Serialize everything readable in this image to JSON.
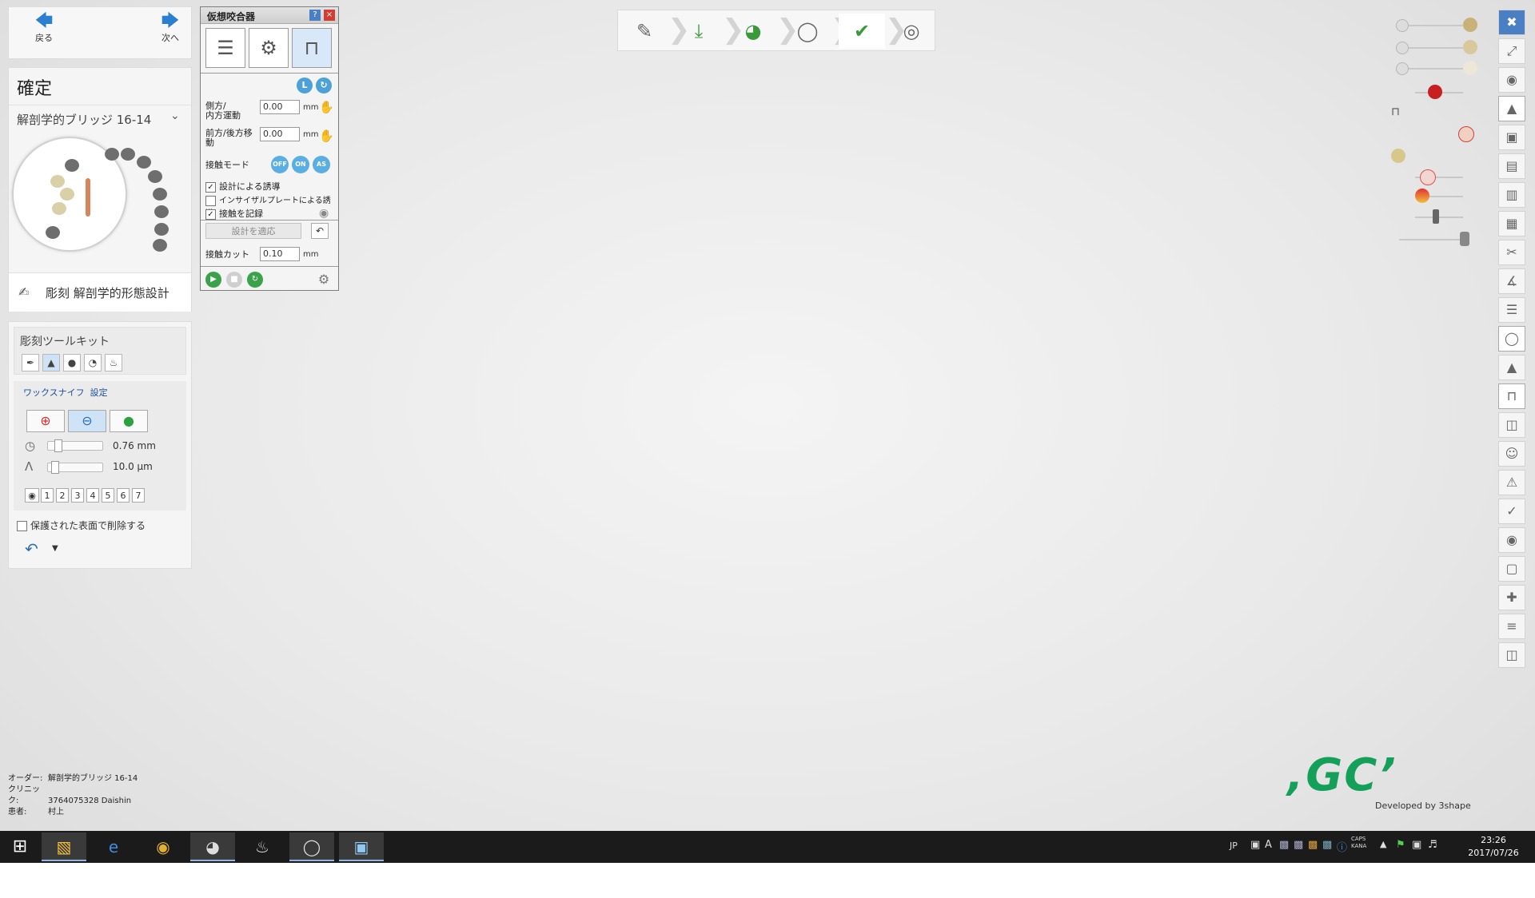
{
  "nav": {
    "back_label": "戻る",
    "next_label": "次へ"
  },
  "confirm_panel": {
    "title": "確定",
    "case_select": "解剖学的ブリッジ 16-14",
    "step_label": "彫刻 解剖学的形態設計"
  },
  "toolkit": {
    "title": "彫刻ツールキット",
    "wax_knife_label": "ワックスナイフ",
    "settings_label": "設定",
    "size_value": "0.76 mm",
    "strength_value": "10.0 μm",
    "numbers": [
      "1",
      "2",
      "3",
      "4",
      "5",
      "6",
      "7"
    ],
    "protect_label": "保護された表面で削除する"
  },
  "articulator": {
    "title": "仮想咬合器",
    "help": "?",
    "close": "×",
    "lateral_label": "側方/\n内方運動",
    "lateral_value": "0.00",
    "protrusive_label": "前方/後方移\n動",
    "protrusive_value": "0.00",
    "unit_mm": "mm",
    "contact_mode_label": "接触モード",
    "contact_modes": [
      "OFF",
      "ON",
      "AS"
    ],
    "check_design_guide": "設計による誘導",
    "check_incisal_guide": "インサイザルプレートによる誘導",
    "check_record_contact": "接触を記録",
    "apply_design": "設計を適応",
    "contact_cut_label": "接触カット",
    "contact_cut_value": "0.10"
  },
  "order_info": {
    "order_key": "オーダー:",
    "order_val": "解剖学的ブリッジ 16-14",
    "clinic_key": "クリニック:",
    "clinic_val": "3764075328 Daishin",
    "patient_key": "患者:",
    "patient_val": "村上"
  },
  "logo": {
    "mark": "‚GC’",
    "developed": "Developed by 3shape"
  },
  "taskbar": {
    "lang": "JP",
    "ime": "A",
    "caps": "CAPS",
    "kana": "KANA",
    "time": "23:26",
    "date": "2017/07/26"
  },
  "colors": {
    "accent": "#2a7fd0",
    "logo_green": "#15a05a",
    "bridge_ivory": "#e9dfc0",
    "blue_highlight": "#1a1ae0",
    "close_red": "#d43c32"
  }
}
